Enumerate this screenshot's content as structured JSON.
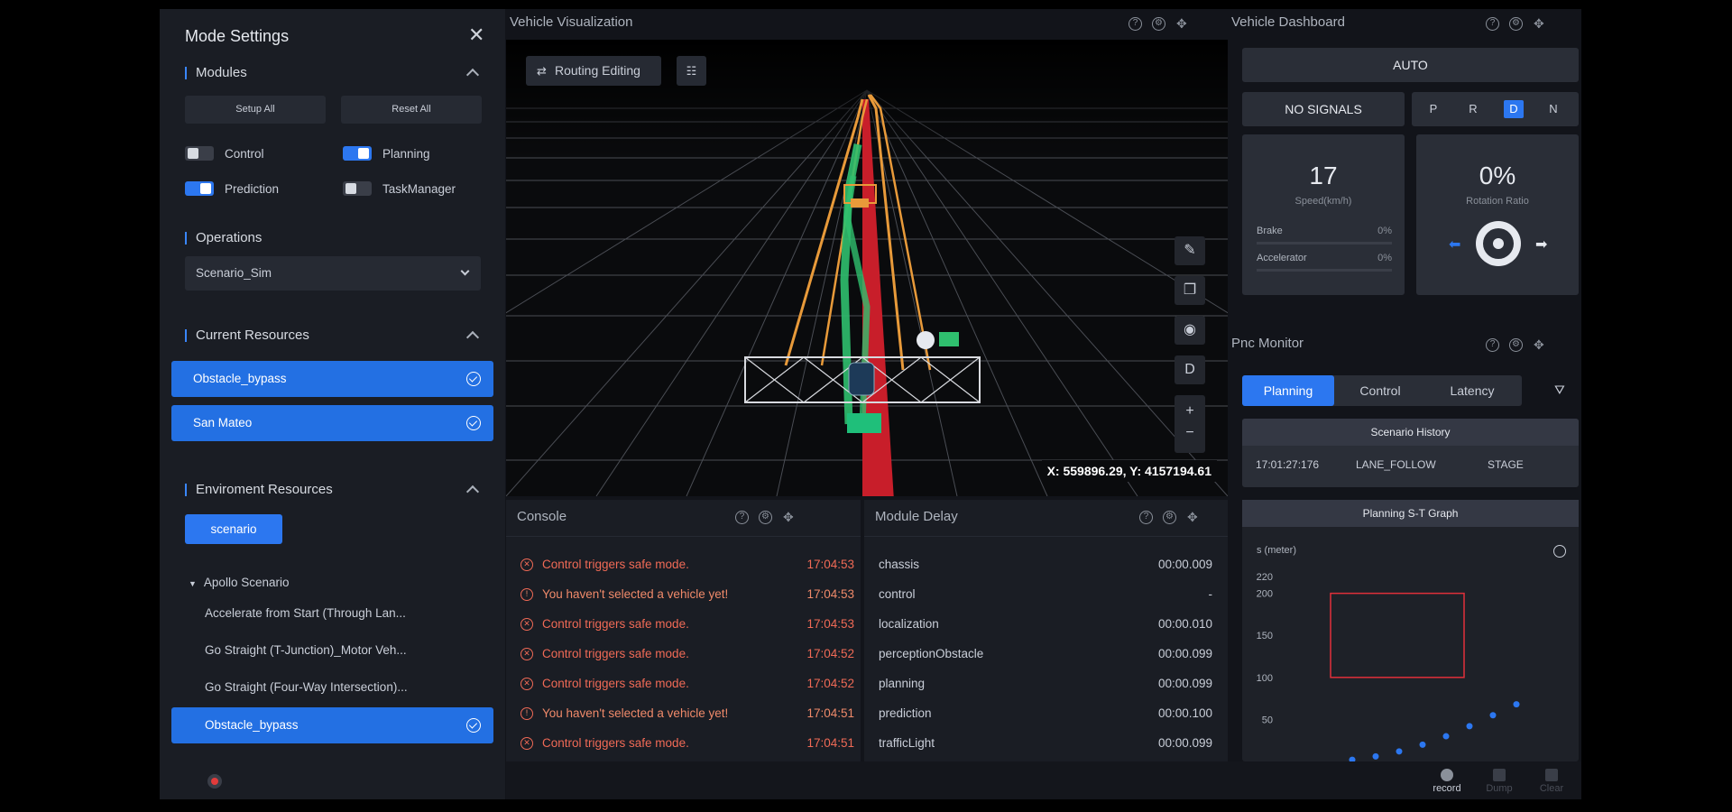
{
  "mode_settings": {
    "title": "Mode Settings",
    "modules": {
      "title": "Modules",
      "setup_all": "Setup All",
      "reset_all": "Reset All",
      "items": [
        {
          "label": "Control",
          "on": false
        },
        {
          "label": "Planning",
          "on": true
        },
        {
          "label": "Prediction",
          "on": true
        },
        {
          "label": "TaskManager",
          "on": false
        }
      ]
    },
    "operations": {
      "title": "Operations",
      "selected": "Scenario_Sim"
    },
    "current_resources": {
      "title": "Current Resources",
      "items": [
        "Obstacle_bypass",
        "San Mateo"
      ]
    },
    "environment_resources": {
      "title": "Enviroment Resources",
      "tab": "scenario",
      "group": "Apollo Scenario",
      "items": [
        "Accelerate from Start (Through Lan...",
        "Go Straight (T-Junction)_Motor Veh...",
        "Go Straight (Four-Way Intersection)...",
        "Obstacle_bypass"
      ],
      "selected_index": 3
    }
  },
  "vehicle_visualization": {
    "title": "Vehicle Visualization",
    "routing_editing": "Routing Editing",
    "tool_d": "D",
    "coords": "X: 559896.29, Y: 4157194.61"
  },
  "console": {
    "title": "Console",
    "rows": [
      {
        "type": "error",
        "msg": "Control triggers safe mode.",
        "time": "17:04:53"
      },
      {
        "type": "warn",
        "msg": "You haven't selected a vehicle yet!",
        "time": "17:04:53"
      },
      {
        "type": "error",
        "msg": "Control triggers safe mode.",
        "time": "17:04:53"
      },
      {
        "type": "error",
        "msg": "Control triggers safe mode.",
        "time": "17:04:52"
      },
      {
        "type": "error",
        "msg": "Control triggers safe mode.",
        "time": "17:04:52"
      },
      {
        "type": "warn",
        "msg": "You haven't selected a vehicle yet!",
        "time": "17:04:51"
      },
      {
        "type": "error",
        "msg": "Control triggers safe mode.",
        "time": "17:04:51"
      }
    ]
  },
  "module_delay": {
    "title": "Module Delay",
    "rows": [
      {
        "name": "chassis",
        "value": "00:00.009"
      },
      {
        "name": "control",
        "value": "-"
      },
      {
        "name": "localization",
        "value": "00:00.010"
      },
      {
        "name": "perceptionObstacle",
        "value": "00:00.099"
      },
      {
        "name": "planning",
        "value": "00:00.099"
      },
      {
        "name": "prediction",
        "value": "00:00.100"
      },
      {
        "name": "trafficLight",
        "value": "00:00.099"
      }
    ]
  },
  "dashboard": {
    "title": "Vehicle Dashboard",
    "mode": "AUTO",
    "signals": "NO SIGNALS",
    "gears": [
      "P",
      "R",
      "D",
      "N"
    ],
    "active_gear": "D",
    "speed": "17",
    "speed_label": "Speed(km/h)",
    "brake_label": "Brake",
    "brake_value": "0%",
    "accel_label": "Accelerator",
    "accel_value": "0%",
    "rotation": "0%",
    "rotation_label": "Rotation Ratio"
  },
  "pnc": {
    "title": "Pnc Monitor",
    "tabs": [
      "Planning",
      "Control",
      "Latency"
    ],
    "active_tab": "Planning",
    "scenario_history": {
      "title": "Scenario History",
      "time": "17:01:27:176",
      "scenario": "LANE_FOLLOW",
      "stage": "STAGE"
    },
    "st_graph": {
      "title": "Planning S-T Graph",
      "ylabel": "s (meter)",
      "yticks": [
        "220",
        "200",
        "150",
        "100",
        "50"
      ]
    }
  },
  "bottom_bar": {
    "record": "record",
    "dump": "Dump",
    "clear": "Clear"
  },
  "colors": {
    "accent": "#2c77f0",
    "error": "#f06a56",
    "panel": "#1a1d24"
  },
  "chart_data": {
    "type": "scatter",
    "title": "Planning S-T Graph",
    "ylabel": "s (meter)",
    "ylim": [
      0,
      220
    ],
    "yticks": [
      50,
      100,
      150,
      200,
      220
    ],
    "series": [
      {
        "values": [
          2,
          6,
          12,
          20,
          30,
          42,
          55,
          68
        ]
      }
    ]
  }
}
